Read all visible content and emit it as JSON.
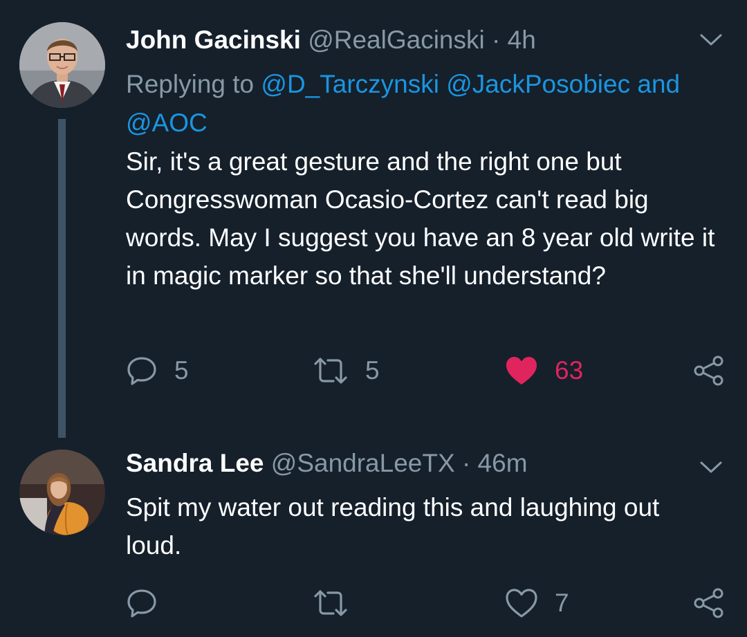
{
  "tweets": [
    {
      "author": {
        "name": "John Gacinski",
        "handle": "@RealGacinski",
        "separator": "·",
        "time": "4h",
        "avatar": "avatar-man-in-suit"
      },
      "replying": {
        "prefix": "Replying to",
        "mention_1": "@D_Tarczynski",
        "mention_2": "@JackPosobiec",
        "conjunction": "and",
        "mention_3": "@AOC"
      },
      "text": "Sir, it's a great gesture and the right one but Congresswoman Ocasio-Cortez can't read big words. May I suggest you have an 8 year old write it in magic marker so that she'll understand?",
      "actions": {
        "reply_count": "5",
        "retweet_count": "5",
        "like_count": "63",
        "liked": true
      },
      "icons": [
        "reply-icon",
        "retweet-icon",
        "heart-filled-icon",
        "share-icon",
        "chevron-down-icon"
      ]
    },
    {
      "author": {
        "name": "Sandra Lee",
        "handle": "@SandraLeeTX",
        "separator": "·",
        "time": "46m",
        "avatar": "avatar-woman-with-pumpkin"
      },
      "text": "Spit my water out reading this and laughing out loud.",
      "actions": {
        "reply_count": "",
        "retweet_count": "",
        "like_count": "7",
        "liked": false
      },
      "icons": [
        "reply-icon",
        "retweet-icon",
        "heart-outline-icon",
        "share-icon",
        "chevron-down-icon"
      ]
    }
  ],
  "colors": {
    "background": "#15202b",
    "secondary_text": "#8899a6",
    "link": "#1b95e0",
    "like": "#e0245e",
    "thread_line": "#3d5466"
  }
}
